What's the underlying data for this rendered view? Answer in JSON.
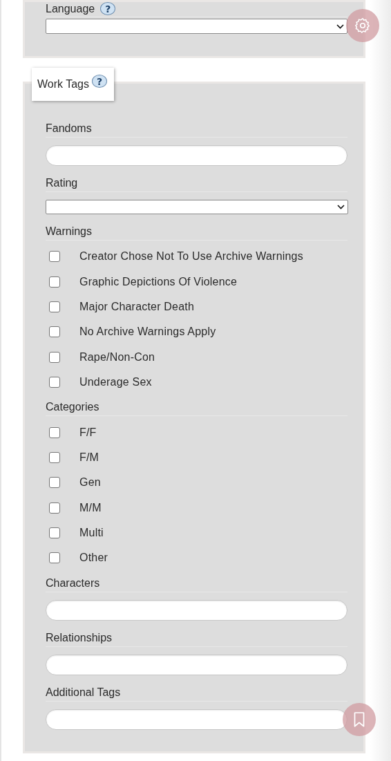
{
  "language_section": {
    "label": "Language",
    "help": "?",
    "fields": [
      {
        "kind": "select"
      }
    ]
  },
  "work_tags": {
    "legend": "Work Tags",
    "help": "?",
    "fields": [
      {
        "kind": "text",
        "label": "Fandoms"
      },
      {
        "kind": "select",
        "label": "Rating"
      },
      {
        "kind": "checkboxes",
        "label": "Warnings",
        "options": [
          {
            "label": "Creator Chose Not To Use Archive Warnings",
            "checked": false
          },
          {
            "label": "Graphic Depictions Of Violence",
            "checked": false
          },
          {
            "label": "Major Character Death",
            "checked": false
          },
          {
            "label": "No Archive Warnings Apply",
            "checked": false
          },
          {
            "label": "Rape/Non-Con",
            "checked": false
          },
          {
            "label": "Underage Sex",
            "checked": false
          }
        ]
      },
      {
        "kind": "checkboxes",
        "label": "Categories",
        "options": [
          {
            "label": "F/F",
            "checked": false
          },
          {
            "label": "F/M",
            "checked": false
          },
          {
            "label": "Gen",
            "checked": false
          },
          {
            "label": "M/M",
            "checked": false
          },
          {
            "label": "Multi",
            "checked": false
          },
          {
            "label": "Other",
            "checked": false
          }
        ]
      },
      {
        "kind": "text",
        "label": "Characters"
      },
      {
        "kind": "text",
        "label": "Relationships"
      },
      {
        "kind": "text",
        "label": "Additional Tags"
      }
    ]
  }
}
